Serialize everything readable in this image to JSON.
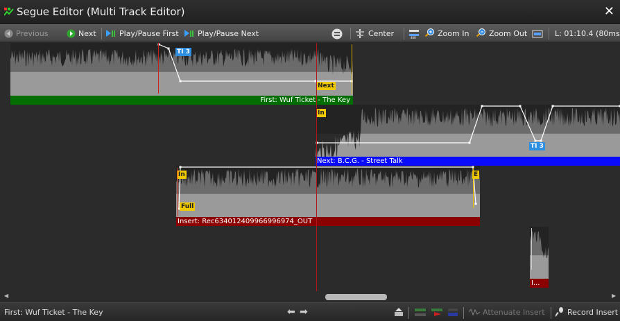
{
  "window": {
    "title": "Segue Editor (Multi Track Editor)",
    "close_glyph": "✕"
  },
  "toolbar": {
    "previous_label": "Previous",
    "next_label": "Next",
    "play_pause_first_label": "Play/Pause First",
    "play_pause_next_label": "Play/Pause Next",
    "center_label": "Center",
    "zoom_in_label": "Zoom In",
    "zoom_out_label": "Zoom Out",
    "length_readout": "L: 01:10.4 (80ms)"
  },
  "tracks": {
    "first": {
      "label": "First: Wuf Ticket - The Key",
      "color": "#006e00",
      "tags": {
        "ti": "TI 3",
        "next": "Next"
      }
    },
    "next": {
      "label": "Next: B.C.G. - Street Talk",
      "color": "#0a0aff",
      "tags": {
        "in": "In",
        "ti": "TI 3"
      }
    },
    "insert": {
      "label": "Insert: Rec634012409966996974_OUT",
      "color": "#8b0000",
      "tags": {
        "in": "In",
        "full": "Full",
        "end": "E"
      }
    },
    "small": {
      "label": "I...",
      "color": "#8b0000"
    }
  },
  "statusbar": {
    "current_track": "First: Wuf Ticket - The Key",
    "attenuate_insert_label": "Attenuate Insert",
    "record_insert_label": "Record Insert"
  },
  "icons": {
    "app": "app-logo-icon",
    "previous": "previous-icon",
    "next": "next-icon",
    "play_first": "play-pause-first-icon",
    "play_next": "play-pause-next-icon",
    "center": "center-icon",
    "zoom_in": "zoom-in-icon",
    "zoom_out": "zoom-out-icon",
    "fit": "fit-icon",
    "align": "align-icon",
    "arrow_left": "arrow-left-icon",
    "arrow_right": "arrow-right-icon"
  }
}
